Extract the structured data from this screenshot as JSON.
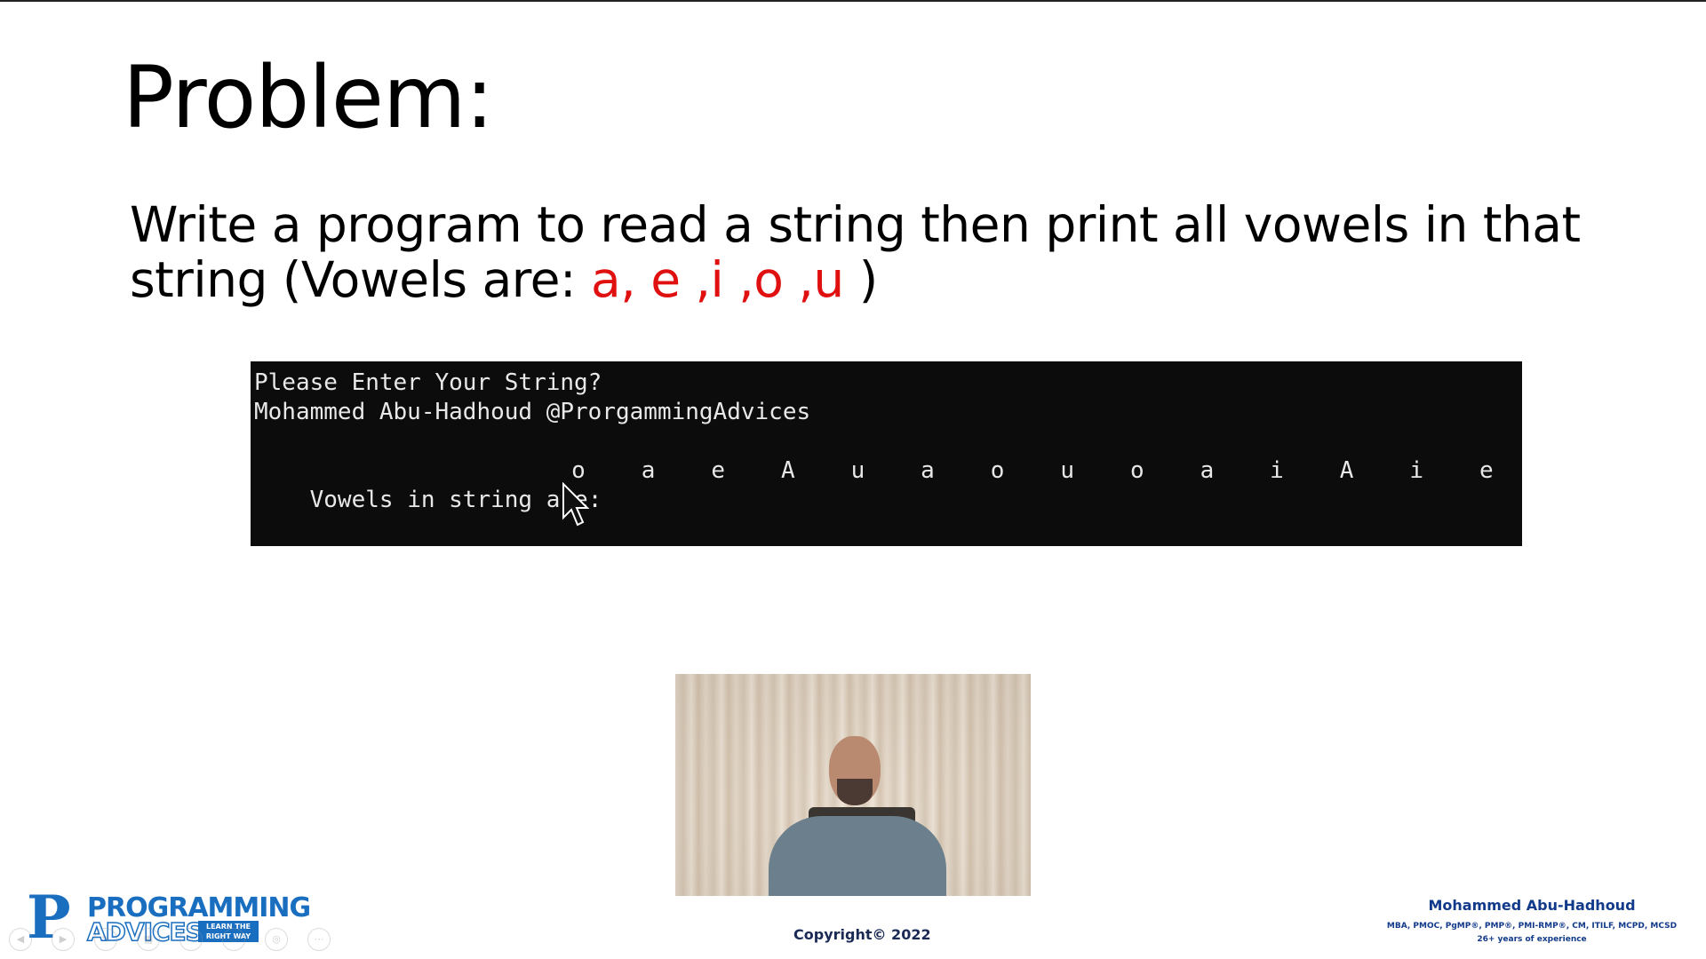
{
  "slide": {
    "title": "Problem:",
    "problem_text_1": "Write a program to read a string then print all vowels in that",
    "problem_text_2": "string  (Vowels are: ",
    "vowels_highlight": "a, e ,i ,o ,u",
    "problem_text_3": " )"
  },
  "console": {
    "prompt": "Please Enter Your String?",
    "input": "Mohammed Abu-Hadhoud @ProrgammingAdvices",
    "result_label": "Vowels in string are:",
    "vowels": [
      "o",
      "a",
      "e",
      "A",
      "u",
      "a",
      "o",
      "u",
      "o",
      "a",
      "i",
      "A",
      "i",
      "e"
    ]
  },
  "footer": {
    "logo_line1": "PROGRAMMING",
    "logo_line2": "ADVICES",
    "logo_tag_1": "LEARN THE",
    "logo_tag_2": "RIGHT WAY",
    "copyright": "Copyright© 2022",
    "author_name": "Mohammed Abu-Hadhoud",
    "author_credentials": "MBA, PMOC, PgMP®, PMP®, PMI-RMP®, CM, ITILF, MCPD, MCSD",
    "author_experience": "26+ years of experience"
  },
  "colors": {
    "accent_red": "#e01010",
    "brand_blue": "#1a6ec0",
    "console_bg": "#0c0c0c"
  }
}
